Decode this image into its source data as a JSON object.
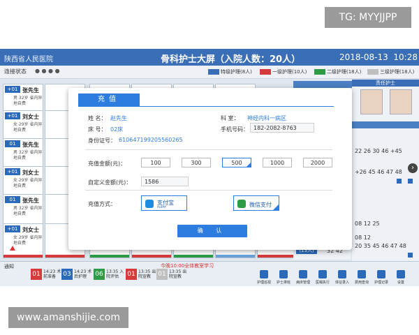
{
  "watermarks": {
    "top": "TG: MYYJJPP",
    "bottom": "www.amanshijie.com"
  },
  "header": {
    "hospital": "陕西省人民医院",
    "center_title": "骨科护士大屏（入院人数：20人）",
    "date": "2018-08-13",
    "time": "10:28"
  },
  "status": {
    "label": "连接状态",
    "dots": "● ● ● ●",
    "legend": [
      {
        "label": "特级护理(8人)",
        "color": "#3a6fb7"
      },
      {
        "label": "一级护理(10人)",
        "color": "#d63a3a"
      },
      {
        "label": "二级护理(18人)",
        "color": "#2e9b45"
      },
      {
        "label": "三级护理(18人)",
        "color": "#bfbfbf"
      }
    ]
  },
  "cards": [
    {
      "bed": "+01",
      "name": "张先生",
      "info": "男 32岁 省内异地自费"
    },
    {
      "bed": "+01",
      "name": "刘女士",
      "info": "女 29岁 省内异地自费"
    },
    {
      "bed": "01",
      "name": "张先生",
      "info": "男 32岁 省内异地自费"
    },
    {
      "bed": "+01",
      "name": "刘女士",
      "info": "女 29岁 省内异地自费"
    },
    {
      "bed": "01",
      "name": "张先生",
      "info": "男 32岁 省内异地自费"
    },
    {
      "bed": "+01",
      "name": "刘女士",
      "info": "女 29岁 省内异地自费"
    }
  ],
  "right_panel": {
    "head": "责任护士",
    "numbers_1": "22  26  30  46  +45",
    "numbers_2": "+26 45 46  47 48",
    "numbers_3": "08  12  25",
    "numbers_4": "08  12",
    "numbers_5": "20 35 45 46 47 48",
    "row_badge": "(13人)",
    "row_val": "32  42"
  },
  "bottom": {
    "label": "通知",
    "alert": "今晚10:00全体教室学习",
    "items": [
      {
        "num": "01",
        "text": "14:23 术前准备",
        "color": "#d63a3a"
      },
      {
        "num": "03",
        "text": "14:23 术后护理",
        "color": "#2a6ab8"
      },
      {
        "num": "06",
        "text": "13:35 入院评估",
        "color": "#2e9b45"
      },
      {
        "num": "01",
        "text": "13:35 出院宣教",
        "color": "#d63a3a"
      },
      {
        "num": "01",
        "text": "13:35 出院宣教",
        "color": "#bfbfbf"
      }
    ],
    "icons": [
      "护理巡视",
      "护士排班",
      "病床管理",
      "医嘱执行",
      "体征录入",
      "费用查询",
      "护理记录",
      "设置"
    ]
  },
  "dialog": {
    "tab": "充值",
    "name_label": "姓  名：",
    "name_value": "赵先生",
    "dept_label": "科  室：",
    "dept_value": "神经内科一病区",
    "bed_label": "床  号：",
    "bed_value": "02床",
    "phone_label": "手机号码：",
    "phone_value": "182-2082-8763",
    "id_label": "身份证号：",
    "id_value": "610647199205560265",
    "amount_label": "充值金额(元)：",
    "amounts": [
      "100",
      "300",
      "500",
      "1000",
      "2000"
    ],
    "selected_amount_index": 2,
    "custom_label": "自定义金额(元)：",
    "custom_value": "1586",
    "method_label": "充值方式：",
    "alipay_label": "支付宝",
    "alipay_sub": "ALIPAY",
    "wechat_label": "微信支付",
    "confirm_label": "确 认"
  }
}
